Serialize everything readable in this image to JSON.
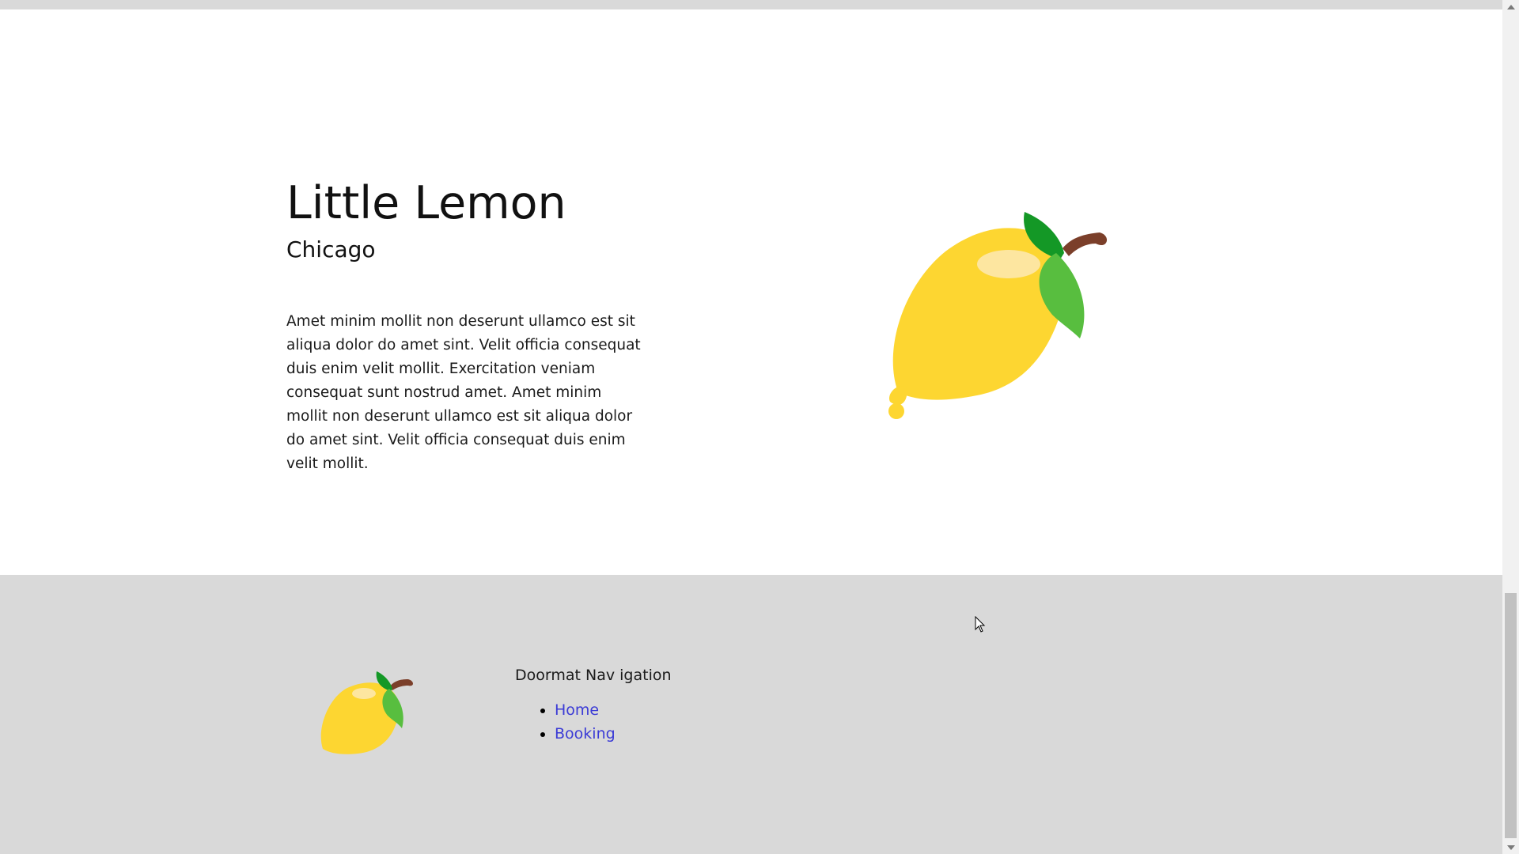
{
  "hero": {
    "title": "Little Lemon",
    "subtitle": "Chicago",
    "body": "Amet minim mollit non deserunt ullamco est sit aliqua dolor do amet sint. Velit officia consequat duis enim velit mollit. Exercitation veniam consequat sunt nostrud amet. Amet minim mollit non deserunt ullamco est sit aliqua dolor do amet sint. Velit officia consequat duis enim velit mollit.",
    "image_icon": "lemon-icon"
  },
  "footer": {
    "logo_icon": "lemon-icon",
    "nav_heading": "Doormat Nav igation",
    "nav_links": [
      {
        "label": "Home"
      },
      {
        "label": "Booking"
      }
    ]
  },
  "colors": {
    "lemon": "#FDD631",
    "lemon_highlight": "#FDE6A0",
    "leaf_dark": "#149826",
    "leaf_light": "#58BE3F",
    "stem": "#7B3F2A",
    "footer_bg": "#D9D9D9",
    "link": "#3B3BD6"
  }
}
